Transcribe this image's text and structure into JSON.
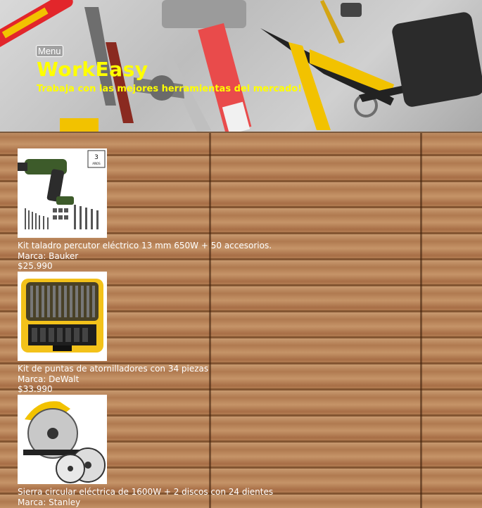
{
  "header": {
    "menu_label": "Menu",
    "title": "WorkEasy",
    "tagline": "Trabaja con las mejores herramientas del mercado!"
  },
  "products": [
    {
      "name": "Kit taladro percutor eléctrico 13 mm 650W + 50 accesorios.",
      "brand": "Marca: Bauker",
      "price": "$25.990",
      "image_icon": "drill-kit-image",
      "badge_text": "3 AÑOS GARANTÍA"
    },
    {
      "name": "Kit de puntas de atornilladores con 34 piezas",
      "brand": "Marca: DeWalt",
      "price": "$33.990",
      "image_icon": "screwdriver-bits-image"
    },
    {
      "name": "Sierra circular eléctrica de 1600W + 2 discos con 24 dientes",
      "brand": "Marca: Stanley",
      "price": "",
      "image_icon": "circular-saw-image"
    }
  ],
  "colors": {
    "title": "#ffff00",
    "text": "#ffffff",
    "wood": "#b9855a"
  }
}
